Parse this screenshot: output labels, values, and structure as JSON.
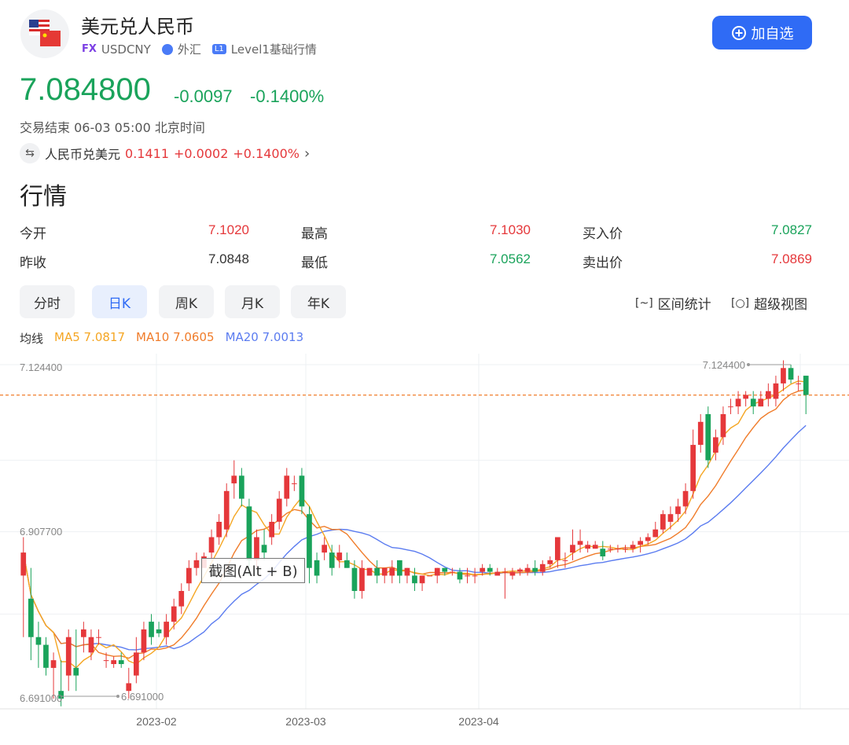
{
  "header": {
    "title": "美元兑人民币",
    "fx_badge": "FX",
    "symbol": "USDCNY",
    "category": "外汇",
    "level_badge": "L1",
    "level_text": "Level1基础行情",
    "add_button": "加自选"
  },
  "quote": {
    "price": "7.084800",
    "change": "-0.0097",
    "change_pct": "-0.1400%",
    "status": "交易结束 06-03 05:00 北京时间",
    "reverse_label": "人民币兑美元",
    "reverse_price": "0.1411",
    "reverse_change": "+0.0002",
    "reverse_pct": "+0.1400%"
  },
  "section_title": "行情",
  "stats": {
    "open_label": "今开",
    "open": "7.1020",
    "high_label": "最高",
    "high": "7.1030",
    "bid_label": "买入价",
    "bid": "7.0827",
    "prev_label": "昨收",
    "prev": "7.0848",
    "low_label": "最低",
    "low": "7.0562",
    "ask_label": "卖出价",
    "ask": "7.0869"
  },
  "tabs": [
    "分时",
    "日K",
    "周K",
    "月K",
    "年K"
  ],
  "active_tab": 1,
  "tools": {
    "range_stats": "区间统计",
    "super_view": "超级视图"
  },
  "ma_legend": {
    "label": "均线",
    "ma5": "MA5 7.0817",
    "ma10": "MA10 7.0605",
    "ma20": "MA20 7.0013"
  },
  "tooltip": "截图(Alt + B)",
  "colors": {
    "up": "#e5383b",
    "down": "#1aa35b",
    "accent": "#2f6bf5",
    "ma5": "#f5a623",
    "ma10": "#f07c2a",
    "ma20": "#5b7cf0"
  },
  "chart_data": {
    "type": "candlestick",
    "y_ticks": [
      "7.124400",
      "6.907700",
      "6.691000"
    ],
    "ylim": [
      6.691,
      7.1244
    ],
    "x_ticks": [
      "2023-02",
      "2023-03",
      "2023-04"
    ],
    "max_label": "7.124400",
    "min_label": "6.691000",
    "last_close": 7.0848,
    "candles": [
      [
        6.85,
        6.9,
        6.77,
        6.88
      ],
      [
        6.82,
        6.86,
        6.74,
        6.77
      ],
      [
        6.77,
        6.79,
        6.73,
        6.76
      ],
      [
        6.76,
        6.77,
        6.72,
        6.73
      ],
      [
        6.73,
        6.75,
        6.69,
        6.74
      ],
      [
        6.7,
        6.74,
        6.68,
        6.69
      ],
      [
        6.72,
        6.78,
        6.7,
        6.77
      ],
      [
        6.73,
        6.78,
        6.7,
        6.72
      ],
      [
        6.77,
        6.79,
        6.75,
        6.78
      ],
      [
        6.75,
        6.78,
        6.74,
        6.77
      ],
      [
        6.77,
        6.78,
        6.76,
        6.77
      ],
      [
        6.74,
        6.75,
        6.73,
        6.74
      ],
      [
        6.735,
        6.745,
        6.73,
        6.74
      ],
      [
        6.74,
        6.75,
        6.73,
        6.735
      ],
      [
        6.7,
        6.73,
        6.69,
        6.71
      ],
      [
        6.72,
        6.77,
        6.71,
        6.75
      ],
      [
        6.75,
        6.79,
        6.74,
        6.78
      ],
      [
        6.79,
        6.8,
        6.76,
        6.77
      ],
      [
        6.78,
        6.79,
        6.77,
        6.775
      ],
      [
        6.77,
        6.8,
        6.76,
        6.79
      ],
      [
        6.79,
        6.82,
        6.78,
        6.81
      ],
      [
        6.81,
        6.84,
        6.8,
        6.83
      ],
      [
        6.84,
        6.87,
        6.83,
        6.86
      ],
      [
        6.86,
        6.88,
        6.85,
        6.87
      ],
      [
        6.86,
        6.88,
        6.86,
        6.875
      ],
      [
        6.88,
        6.91,
        6.87,
        6.9
      ],
      [
        6.9,
        6.93,
        6.89,
        6.92
      ],
      [
        6.91,
        6.97,
        6.9,
        6.96
      ],
      [
        6.97,
        7.0,
        6.95,
        6.98
      ],
      [
        6.98,
        6.99,
        6.94,
        6.95
      ],
      [
        6.94,
        6.95,
        6.85,
        6.87
      ],
      [
        6.87,
        6.91,
        6.86,
        6.9
      ],
      [
        6.89,
        6.91,
        6.87,
        6.88
      ],
      [
        6.9,
        6.93,
        6.89,
        6.92
      ],
      [
        6.92,
        6.96,
        6.91,
        6.95
      ],
      [
        6.95,
        6.99,
        6.94,
        6.98
      ],
      [
        6.97,
        6.98,
        6.96,
        6.97
      ],
      [
        6.98,
        6.99,
        6.93,
        6.94
      ],
      [
        6.93,
        6.94,
        6.84,
        6.86
      ],
      [
        6.87,
        6.88,
        6.84,
        6.85
      ],
      [
        6.88,
        6.9,
        6.87,
        6.89
      ],
      [
        6.88,
        6.89,
        6.85,
        6.86
      ],
      [
        6.87,
        6.89,
        6.86,
        6.88
      ],
      [
        6.87,
        6.88,
        6.86,
        6.86
      ],
      [
        6.86,
        6.87,
        6.82,
        6.83
      ],
      [
        6.83,
        6.87,
        6.82,
        6.86
      ],
      [
        6.85,
        6.86,
        6.85,
        6.86
      ],
      [
        6.86,
        6.87,
        6.84,
        6.85
      ],
      [
        6.85,
        6.86,
        6.84,
        6.86
      ],
      [
        6.85,
        6.87,
        6.84,
        6.86
      ],
      [
        6.87,
        6.87,
        6.84,
        6.85
      ],
      [
        6.85,
        6.86,
        6.84,
        6.86
      ],
      [
        6.85,
        6.86,
        6.83,
        6.84
      ],
      [
        6.84,
        6.85,
        6.83,
        6.85
      ],
      [
        6.85,
        6.85,
        6.85,
        6.85
      ],
      [
        6.85,
        6.86,
        6.84,
        6.86
      ],
      [
        6.86,
        6.86,
        6.85,
        6.855
      ],
      [
        6.855,
        6.86,
        6.85,
        6.855
      ],
      [
        6.855,
        6.86,
        6.84,
        6.845
      ],
      [
        6.85,
        6.86,
        6.84,
        6.85
      ],
      [
        6.85,
        6.86,
        6.84,
        6.85
      ],
      [
        6.855,
        6.865,
        6.85,
        6.86
      ],
      [
        6.86,
        6.865,
        6.85,
        6.855
      ],
      [
        6.85,
        6.86,
        6.85,
        6.855
      ],
      [
        6.855,
        6.86,
        6.82,
        6.855
      ],
      [
        6.85,
        6.86,
        6.845,
        6.855
      ],
      [
        6.855,
        6.86,
        6.85,
        6.858
      ],
      [
        6.855,
        6.865,
        6.85,
        6.86
      ],
      [
        6.86,
        6.87,
        6.85,
        6.855
      ],
      [
        6.855,
        6.87,
        6.85,
        6.865
      ],
      [
        6.865,
        6.875,
        6.86,
        6.87
      ],
      [
        6.87,
        6.9,
        6.86,
        6.9
      ],
      [
        6.87,
        6.88,
        6.86,
        6.87
      ],
      [
        6.88,
        6.91,
        6.87,
        6.89
      ],
      [
        6.89,
        6.91,
        6.88,
        6.895
      ],
      [
        6.885,
        6.895,
        6.88,
        6.89
      ],
      [
        6.885,
        6.895,
        6.885,
        6.89
      ],
      [
        6.885,
        6.895,
        6.87,
        6.875
      ],
      [
        6.885,
        6.89,
        6.88,
        6.885
      ],
      [
        6.885,
        6.89,
        6.88,
        6.885
      ],
      [
        6.885,
        6.89,
        6.88,
        6.885
      ],
      [
        6.885,
        6.895,
        6.88,
        6.89
      ],
      [
        6.89,
        6.9,
        6.88,
        6.895
      ],
      [
        6.895,
        6.905,
        6.89,
        6.9
      ],
      [
        6.9,
        6.92,
        6.9,
        6.91
      ],
      [
        6.91,
        6.935,
        6.905,
        6.93
      ],
      [
        6.92,
        6.94,
        6.91,
        6.93
      ],
      [
        6.93,
        6.95,
        6.92,
        6.94
      ],
      [
        6.94,
        6.97,
        6.93,
        6.96
      ],
      [
        6.96,
        7.04,
        6.95,
        7.02
      ],
      [
        7.02,
        7.06,
        7.01,
        7.05
      ],
      [
        7.06,
        7.07,
        6.99,
        7.0
      ],
      [
        7.01,
        7.04,
        7.0,
        7.03
      ],
      [
        7.03,
        7.07,
        7.02,
        7.06
      ],
      [
        7.07,
        7.08,
        7.06,
        7.07
      ],
      [
        7.07,
        7.09,
        7.06,
        7.08
      ],
      [
        7.08,
        7.09,
        7.07,
        7.085
      ],
      [
        7.08,
        7.09,
        7.06,
        7.07
      ],
      [
        7.07,
        7.09,
        7.07,
        7.08
      ],
      [
        7.08,
        7.1,
        7.07,
        7.09
      ],
      [
        7.08,
        7.11,
        7.07,
        7.1
      ],
      [
        7.1,
        7.13,
        7.09,
        7.12
      ],
      [
        7.12,
        7.1244,
        7.1,
        7.105
      ],
      [
        7.1,
        7.11,
        7.09,
        7.1
      ],
      [
        7.11,
        7.11,
        7.06,
        7.085
      ]
    ]
  }
}
